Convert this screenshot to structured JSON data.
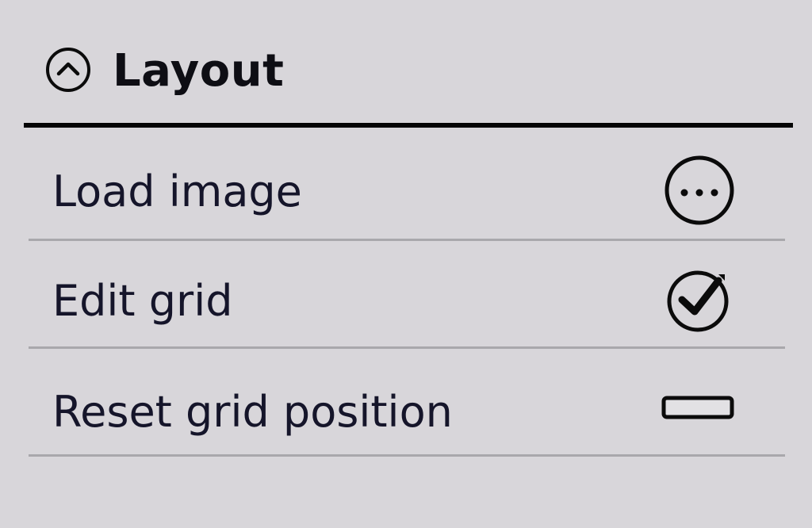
{
  "section": {
    "title": "Layout",
    "collapse_icon": "chevron-up-circle-icon",
    "expanded": true
  },
  "rows": [
    {
      "label": "Load image",
      "icon": "more-options-icon",
      "control": "button"
    },
    {
      "label": "Edit grid",
      "icon": "checkbox-checked-icon",
      "control": "toggle",
      "checked": true
    },
    {
      "label": "Reset grid position",
      "icon": "reset-button-icon",
      "control": "button"
    }
  ],
  "colors": {
    "background": "#d8d6da",
    "text": "#15152a",
    "header_rule": "#050505",
    "divider": "#a9a8ac"
  }
}
